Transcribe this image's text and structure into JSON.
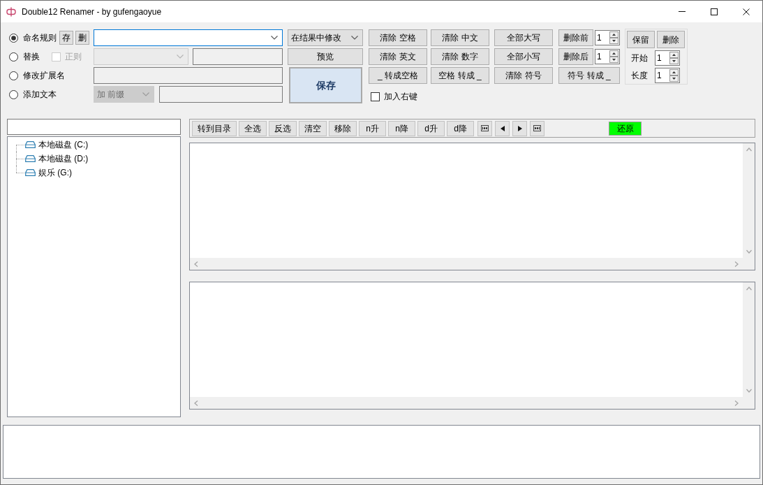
{
  "window": {
    "title": "Double12 Renamer - by gufengaoyue"
  },
  "modes": [
    {
      "kind": "rule",
      "label": "命名规则",
      "selected": true,
      "buttons": [
        "存",
        "删"
      ]
    },
    {
      "kind": "replace",
      "label": "替换",
      "selected": false,
      "regex": {
        "label": "正则",
        "checked": false
      }
    },
    {
      "kind": "extension",
      "label": "修改扩展名",
      "selected": false
    },
    {
      "kind": "add_text",
      "label": "添加文本",
      "selected": false,
      "position": "加 前缀"
    }
  ],
  "apply_mode": "在结果中修改",
  "preview_button": "预览",
  "save_button": "保存",
  "action_columns": [
    [
      "清除 空格",
      "清除 英文",
      "_ 转成空格"
    ],
    [
      "清除 中文",
      "清除 数字",
      "空格 转成 _"
    ],
    [
      "全部大写",
      "全部小写",
      "清除 符号"
    ]
  ],
  "trim": [
    {
      "label": "删除前",
      "value": "1"
    },
    {
      "label": "删除后",
      "value": "1"
    }
  ],
  "symbol_button": "符号 转成 _",
  "context_menu": {
    "label": "加入右键",
    "checked": false
  },
  "range": {
    "buttons": [
      "保留",
      "删除"
    ],
    "spinners": [
      {
        "label": "开始",
        "value": "1"
      },
      {
        "label": "长度",
        "value": "1"
      }
    ]
  },
  "tree": {
    "items": [
      {
        "label": "本地磁盘 (C:)"
      },
      {
        "label": "本地磁盘 (D:)"
      },
      {
        "label": "娱乐 (G:)"
      }
    ]
  },
  "toolbar": {
    "buttons": [
      {
        "kind": "text",
        "label": "转到目录"
      },
      {
        "kind": "text",
        "label": "全选"
      },
      {
        "kind": "text",
        "label": "反选"
      },
      {
        "kind": "text",
        "label": "清空"
      },
      {
        "kind": "text",
        "label": "移除"
      },
      {
        "kind": "text",
        "label": "n升"
      },
      {
        "kind": "text",
        "label": "n降"
      },
      {
        "kind": "text",
        "label": "d升"
      },
      {
        "kind": "text",
        "label": "d降"
      },
      {
        "kind": "first"
      },
      {
        "kind": "prev"
      },
      {
        "kind": "next"
      },
      {
        "kind": "last"
      }
    ],
    "restore_button": "还原"
  }
}
